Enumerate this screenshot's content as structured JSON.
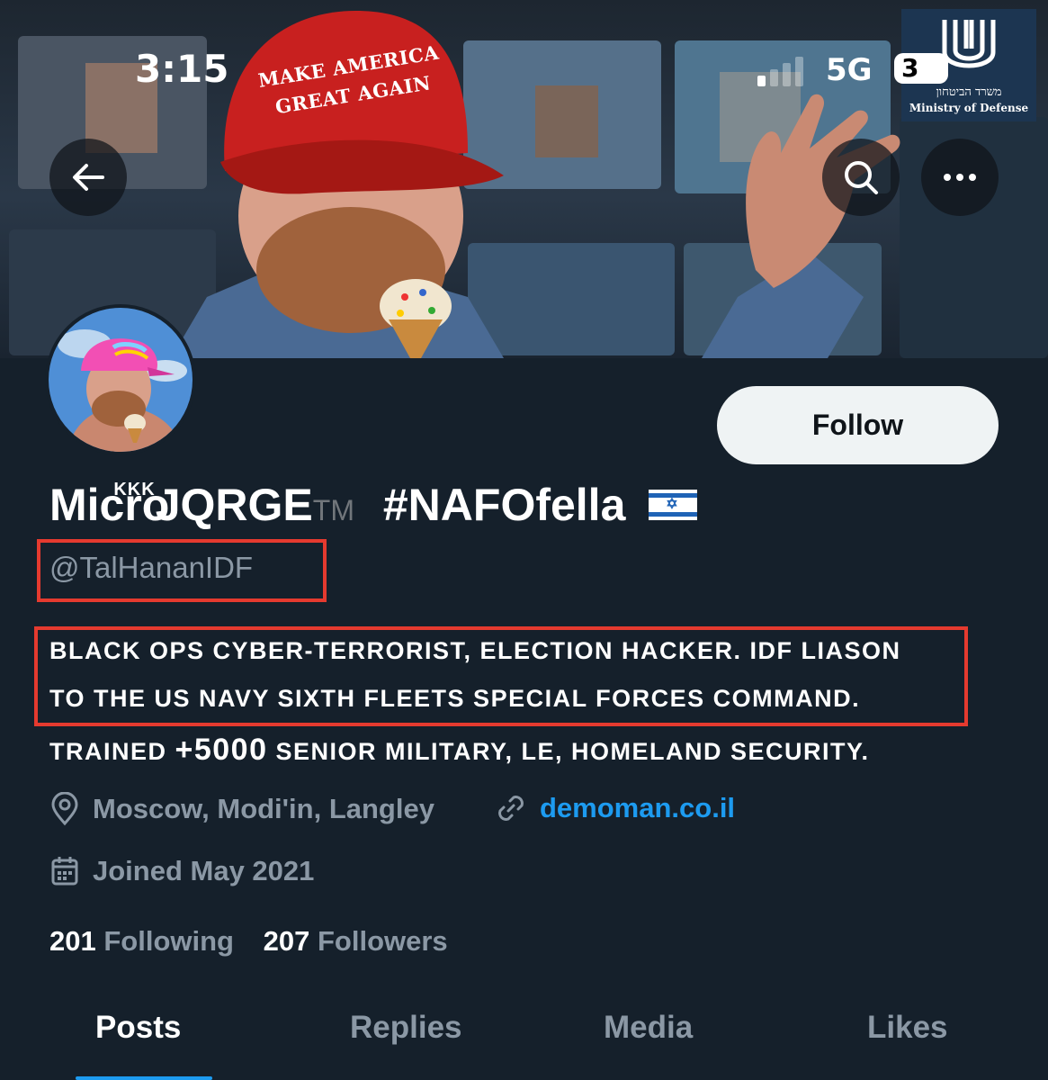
{
  "status_bar": {
    "time": "3:15",
    "network": "5G",
    "battery": "3"
  },
  "header": {
    "hat_text": [
      "MAKE AMERICA",
      "GREAT AGAIN"
    ],
    "logo": {
      "hebrew": "משרד הביטחון",
      "english": "Ministry of Defense"
    }
  },
  "profile": {
    "name_prefix": "Micro",
    "name_superscript": "KKK",
    "name_main": "JQRGE",
    "name_tm": "TM",
    "name_tag": "#NAFOfella",
    "handle": "@TalHananIDF",
    "follow_label": "Follow",
    "bio_lines": [
      "BLACK OPS CYBER-TERRORIST, ELECTION HACKER. IDF LIASON",
      "TO THE US NAVY SIXTH FLEETS SPECIAL FORCES COMMAND."
    ],
    "bio_line3": {
      "before": "TRAINED ",
      "number": "+5000",
      "after": " SENIOR MILITARY, LE, HOMELAND SECURITY."
    },
    "location": "Moscow, Modi'in, Langley",
    "website": "demoman.co.il",
    "joined": "Joined May 2021",
    "following_count": "201",
    "following_label": "Following",
    "followers_count": "207",
    "followers_label": "Followers"
  },
  "tabs": [
    "Posts",
    "Replies",
    "Media",
    "Likes"
  ],
  "colors": {
    "background": "#15202b",
    "accent": "#1d9bf0",
    "annotation": "#e53a2f",
    "hat": "#c8201f"
  },
  "icons": [
    "back-arrow-icon",
    "search-icon",
    "more-icon",
    "location-pin-icon",
    "link-icon",
    "calendar-icon"
  ]
}
